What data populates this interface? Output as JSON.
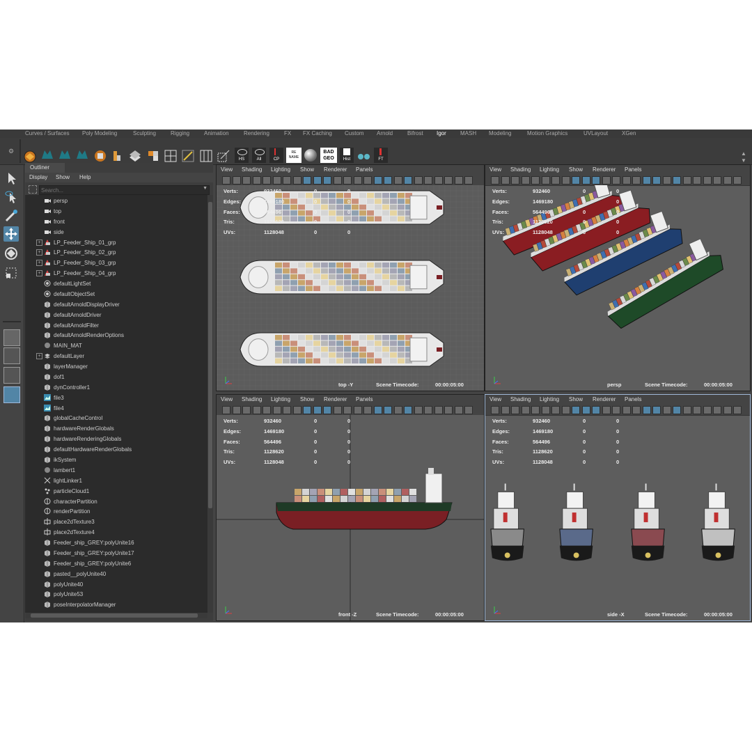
{
  "shelf_tabs": [
    "Curves / Surfaces",
    "Poly Modeling",
    "Sculpting",
    "Rigging",
    "Animation",
    "Rendering",
    "FX",
    "FX Caching",
    "Custom",
    "Arnold",
    "Bifrost",
    "Igor",
    "MASH",
    "Modeling",
    "Motion Graphics",
    "UVLayout",
    "XGen"
  ],
  "active_shelf_tab": "Igor",
  "shelf_labels": {
    "hs": "HS",
    "all": "All",
    "cp": "CP",
    "rename": "RE NAME",
    "badgeo": "BAD GEO",
    "hist": "Hist",
    "ft": "FT"
  },
  "outliner": {
    "tab": "Outliner",
    "menu": [
      "Display",
      "Show",
      "Help"
    ],
    "search_placeholder": "Search...",
    "items": [
      {
        "label": "persp",
        "icon": "camera-icon",
        "expand": false
      },
      {
        "label": "top",
        "icon": "camera-icon",
        "expand": false
      },
      {
        "label": "front",
        "icon": "camera-icon",
        "expand": false
      },
      {
        "label": "side",
        "icon": "camera-icon",
        "expand": false
      },
      {
        "label": "LP_Feeder_Ship_01_grp",
        "icon": "group-icon",
        "expand": true
      },
      {
        "label": "LP_Feeder_Ship_02_grp",
        "icon": "group-icon",
        "expand": true
      },
      {
        "label": "LP_Feeder_Ship_03_grp",
        "icon": "group-icon",
        "expand": true
      },
      {
        "label": "LP_Feeder_Ship_04_grp",
        "icon": "group-icon",
        "expand": true
      },
      {
        "label": "defaultLightSet",
        "icon": "set-icon",
        "expand": false
      },
      {
        "label": "defaultObjectSet",
        "icon": "set-icon",
        "expand": false
      },
      {
        "label": "defaultArnoldDisplayDriver",
        "icon": "node-icon",
        "expand": false
      },
      {
        "label": "defaultArnoldDriver",
        "icon": "node-icon",
        "expand": false
      },
      {
        "label": "defaultArnoldFilter",
        "icon": "node-icon",
        "expand": false
      },
      {
        "label": "defaultArnoldRenderOptions",
        "icon": "node-icon",
        "expand": false
      },
      {
        "label": "MAIN_MAT",
        "icon": "material-icon",
        "expand": false
      },
      {
        "label": "defaultLayer",
        "icon": "layer-icon",
        "expand": true
      },
      {
        "label": "layerManager",
        "icon": "node-icon",
        "expand": false
      },
      {
        "label": "dof1",
        "icon": "node-icon",
        "expand": false
      },
      {
        "label": "dynController1",
        "icon": "node-icon",
        "expand": false
      },
      {
        "label": "file3",
        "icon": "file-texture-icon",
        "expand": false
      },
      {
        "label": "file4",
        "icon": "file-texture-icon",
        "expand": false
      },
      {
        "label": "globalCacheControl",
        "icon": "node-icon",
        "expand": false
      },
      {
        "label": "hardwareRenderGlobals",
        "icon": "node-icon",
        "expand": false
      },
      {
        "label": "hardwareRenderingGlobals",
        "icon": "node-icon",
        "expand": false
      },
      {
        "label": "defaultHardwareRenderGlobals",
        "icon": "node-icon",
        "expand": false
      },
      {
        "label": "ikSystem",
        "icon": "node-icon",
        "expand": false
      },
      {
        "label": "lambert1",
        "icon": "material-icon",
        "expand": false
      },
      {
        "label": "lightLinker1",
        "icon": "light-linker-icon",
        "expand": false
      },
      {
        "label": "particleCloud1",
        "icon": "particle-icon",
        "expand": false
      },
      {
        "label": "characterPartition",
        "icon": "partition-icon",
        "expand": false
      },
      {
        "label": "renderPartition",
        "icon": "partition-icon",
        "expand": false
      },
      {
        "label": "place2dTexture3",
        "icon": "place2d-icon",
        "expand": false
      },
      {
        "label": "place2dTexture4",
        "icon": "place2d-icon",
        "expand": false
      },
      {
        "label": "Feeder_ship_GREY:polyUnite16",
        "icon": "node-icon",
        "expand": false
      },
      {
        "label": "Feeder_ship_GREY:polyUnite17",
        "icon": "node-icon",
        "expand": false
      },
      {
        "label": "Feeder_ship_GREY:polyUnite6",
        "icon": "node-icon",
        "expand": false
      },
      {
        "label": "pasted__polyUnite40",
        "icon": "node-icon",
        "expand": false
      },
      {
        "label": "polyUnite40",
        "icon": "node-icon",
        "expand": false
      },
      {
        "label": "polyUnite53",
        "icon": "node-icon",
        "expand": false
      },
      {
        "label": "poseInterpolatorManager",
        "icon": "node-icon",
        "expand": false
      }
    ]
  },
  "panel_menu": [
    "View",
    "Shading",
    "Lighting",
    "Show",
    "Renderer",
    "Panels"
  ],
  "hud": {
    "labels": [
      "Verts:",
      "Edges:",
      "Faces:",
      "Tris:",
      "UVs:"
    ],
    "values": [
      "932460",
      "1469180",
      "564496",
      "1128620",
      "1128048"
    ],
    "zeros": [
      "0",
      "0"
    ]
  },
  "scene_timecode_label": "Scene Timecode:",
  "timecode": "00:00:05:00",
  "cameras": {
    "tl": "top -Y",
    "tr": "persp",
    "bl": "front -Z",
    "br": "side -X"
  },
  "colors": {
    "accent": "#5285a6",
    "hull_red": "#7a1f24",
    "hull_green": "#1f4a2a",
    "hull_blue": "#1d3f6e",
    "viewport_bg": "#5d5d5d"
  }
}
